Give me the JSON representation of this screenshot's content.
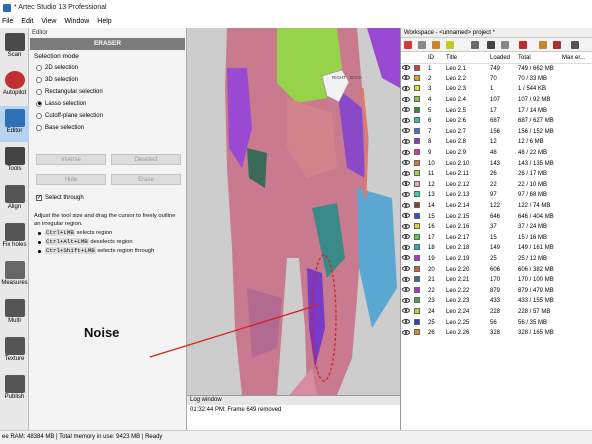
{
  "window": {
    "title": "* Artec Studio 13 Professional"
  },
  "menu": [
    "File",
    "Edit",
    "View",
    "Window",
    "Help"
  ],
  "tools": [
    {
      "label": "Scan",
      "color": "#4a4a4a"
    },
    {
      "label": "Autopilot",
      "color": "#c03030"
    },
    {
      "label": "Editor",
      "color": "#2f6fb5"
    },
    {
      "label": "Tools",
      "color": "#444444"
    },
    {
      "label": "Align",
      "color": "#555555"
    },
    {
      "label": "Fix holes",
      "color": "#555555"
    },
    {
      "label": "Measures",
      "color": "#666666"
    },
    {
      "label": "Multi",
      "color": "#555555"
    },
    {
      "label": "Texture",
      "color": "#555555"
    },
    {
      "label": "Publish",
      "color": "#555555"
    }
  ],
  "editor": {
    "panel_title": "Editor",
    "mode_title": "ERASER",
    "selection_mode_label": "Selection mode",
    "modes": [
      "2D selection",
      "3D selection",
      "Rectangular selection",
      "Lasso selection",
      "Cutoff-plane selection",
      "Base selection"
    ],
    "selected_mode": "Lasso selection",
    "buttons": {
      "inverse": "Inverse",
      "deselect": "Deselect",
      "hide": "Hide",
      "erase": "Erase"
    },
    "select_through": "Select through",
    "help_text": "Adjust the tool size and drag the cursor to freely outline an irregular region.",
    "shortcuts": [
      {
        "key": "Ctrl+LMB",
        "desc": " selects region"
      },
      {
        "key": "Ctrl+Alt+LMB",
        "desc": " deselects region"
      },
      {
        "key": "Ctrl+Shift+LMB",
        "desc": " selects region through"
      }
    ]
  },
  "viewport": {
    "cube_right": "RIGHT",
    "cube_back": "BACK",
    "annotation": "Noise",
    "annotation_color": "#d42020"
  },
  "log": {
    "title": "Log window",
    "line": "01:32:44 PM: Frame 649 removed"
  },
  "workspace": {
    "title": "Workspace - <unnamed> project *",
    "columns": [
      "ID",
      "Title",
      "Loaded",
      "Total",
      "Max er..."
    ],
    "rows": [
      {
        "id": "1",
        "title": "Leo 2.1",
        "loaded": "749",
        "total": "749 / 662 MB",
        "color": "#d23a3a"
      },
      {
        "id": "2",
        "title": "Leo 2.2",
        "loaded": "70",
        "total": "70 / 33 MB",
        "color": "#e0a020"
      },
      {
        "id": "3",
        "title": "Leo 2.3",
        "loaded": "1",
        "total": "1 / 544 KB",
        "color": "#e6dd30"
      },
      {
        "id": "4",
        "title": "Leo 2.4",
        "loaded": "107",
        "total": "107 / 92 MB",
        "color": "#8ac43a"
      },
      {
        "id": "5",
        "title": "Leo 2.5",
        "loaded": "17",
        "total": "17 / 14 MB",
        "color": "#3a8a3a"
      },
      {
        "id": "6",
        "title": "Leo 2.6",
        "loaded": "687",
        "total": "687 / 627 MB",
        "color": "#3ab8a8"
      },
      {
        "id": "7",
        "title": "Leo 2.7",
        "loaded": "156",
        "total": "156 / 152 MB",
        "color": "#3a78d2"
      },
      {
        "id": "8",
        "title": "Leo 2.8",
        "loaded": "12",
        "total": "12 / 6 MB",
        "color": "#8a3ad2"
      },
      {
        "id": "9",
        "title": "Leo 2.9",
        "loaded": "48",
        "total": "48 / 22 MB",
        "color": "#d23aa8"
      },
      {
        "id": "10",
        "title": "Leo 2.10",
        "loaded": "143",
        "total": "143 / 135 MB",
        "color": "#d27a3a"
      },
      {
        "id": "11",
        "title": "Leo 2.11",
        "loaded": "26",
        "total": "26 / 17 MB",
        "color": "#a8d23a"
      },
      {
        "id": "12",
        "title": "Leo 2.12",
        "loaded": "22",
        "total": "22 / 10 MB",
        "color": "#e6a6c8"
      },
      {
        "id": "13",
        "title": "Leo 2.13",
        "loaded": "97",
        "total": "97 / 68 MB",
        "color": "#3ad2a8"
      },
      {
        "id": "14",
        "title": "Leo 2.14",
        "loaded": "122",
        "total": "122 / 74 MB",
        "color": "#7a4a2a"
      },
      {
        "id": "15",
        "title": "Leo 2.15",
        "loaded": "646",
        "total": "646 / 404 MB",
        "color": "#3a4ad2"
      },
      {
        "id": "16",
        "title": "Leo 2.16",
        "loaded": "37",
        "total": "37 / 24 MB",
        "color": "#d2d23a"
      },
      {
        "id": "17",
        "title": "Leo 2.17",
        "loaded": "15",
        "total": "15 / 16 MB",
        "color": "#4ad23a"
      },
      {
        "id": "18",
        "title": "Leo 2.18",
        "loaded": "149",
        "total": "149 / 161 MB",
        "color": "#2aa8d2"
      },
      {
        "id": "19",
        "title": "Leo 2.19",
        "loaded": "25",
        "total": "25 / 12 MB",
        "color": "#a83ad2"
      },
      {
        "id": "20",
        "title": "Leo 2.20",
        "loaded": "606",
        "total": "606 / 382 MB",
        "color": "#d25a3a"
      },
      {
        "id": "21",
        "title": "Leo 2.21",
        "loaded": "170",
        "total": "170 / 100 MB",
        "color": "#3a6a9a"
      },
      {
        "id": "22",
        "title": "Leo 2.22",
        "loaded": "879",
        "total": "879 / 479 MB",
        "color": "#9a3ac8"
      },
      {
        "id": "23",
        "title": "Leo 2.23",
        "loaded": "433",
        "total": "433 / 155 MB",
        "color": "#3aa85a"
      },
      {
        "id": "24",
        "title": "Leo 2.24",
        "loaded": "228",
        "total": "228 / 57 MB",
        "color": "#c8c83a"
      },
      {
        "id": "25",
        "title": "Leo 2.25",
        "loaded": "56",
        "total": "56 / 35 MB",
        "color": "#3a3ab8"
      },
      {
        "id": "26",
        "title": "Leo 2.26",
        "loaded": "328",
        "total": "328 / 165 MB",
        "color": "#d28a3a"
      }
    ]
  },
  "status": {
    "text": "ee RAM: 48384 MB | Total memory in use: 9423 MB | Ready"
  }
}
